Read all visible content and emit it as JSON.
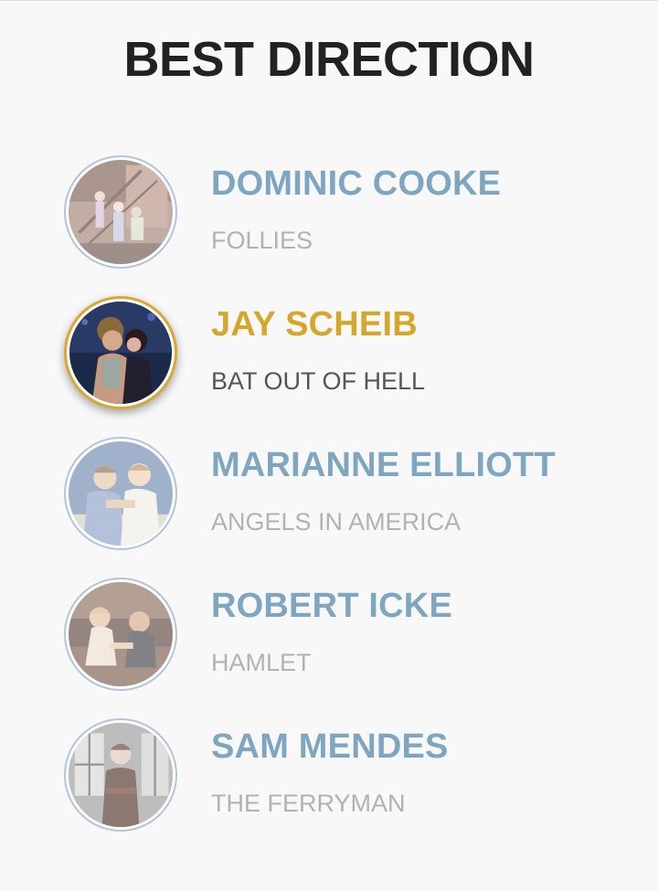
{
  "title": "BEST DIRECTION",
  "nominees": [
    {
      "name": "DOMINIC COOKE",
      "show": "FOLLIES",
      "selected": false,
      "image": "follies-stage-photo"
    },
    {
      "name": "JAY SCHEIB",
      "show": "BAT OUT OF HELL",
      "selected": true,
      "image": "bat-out-of-hell-stage-photo"
    },
    {
      "name": "MARIANNE ELLIOTT",
      "show": "ANGELS IN AMERICA",
      "selected": false,
      "image": "angels-in-america-stage-photo"
    },
    {
      "name": "ROBERT ICKE",
      "show": "HAMLET",
      "selected": false,
      "image": "hamlet-stage-photo"
    },
    {
      "name": "SAM MENDES",
      "show": "THE FERRYMAN",
      "selected": false,
      "image": "the-ferryman-stage-photo"
    }
  ],
  "colors": {
    "background": "#f8f8f8",
    "title": "#222222",
    "name_default": "#7fa6c1",
    "name_selected": "#d4a62a",
    "show_default": "#b2b2b2",
    "show_selected": "#555555",
    "avatar_ring": "#86a9c3",
    "avatar_ring_selected": "#d9a830"
  }
}
